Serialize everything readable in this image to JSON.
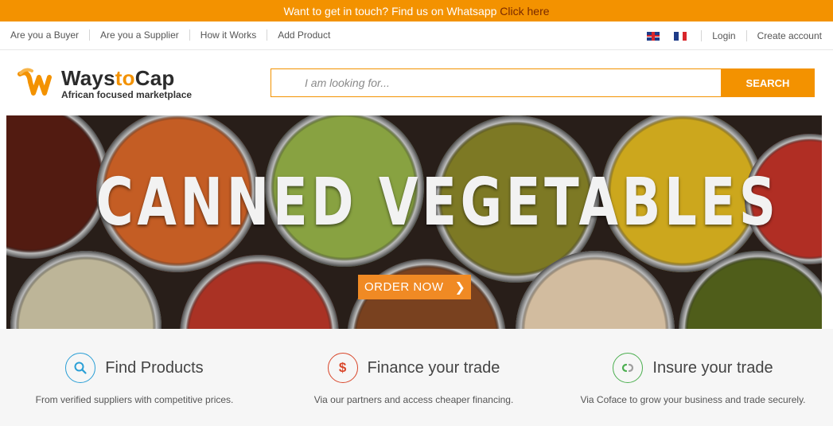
{
  "topbar": {
    "text": "Want to get in touch? Find us on Whatsapp ",
    "cta": "Click here"
  },
  "subnav": {
    "left": [
      "Are you a Buyer",
      "Are you a Supplier",
      "How it Works",
      "Add Product"
    ],
    "login": "Login",
    "create_account": "Create account"
  },
  "logo": {
    "name_a": "Ways",
    "name_b": "to",
    "name_c": "Cap",
    "tagline": "African focused marketplace"
  },
  "search": {
    "placeholder": "I am looking for...",
    "button": "SEARCH"
  },
  "hero": {
    "headline": "CANNED VEGETABLES",
    "cta": "ORDER NOW"
  },
  "features": [
    {
      "title": "Find Products",
      "desc": "From verified suppliers with competitive prices.",
      "icon": "search-icon",
      "color": "#2a9fd6"
    },
    {
      "title": "Finance your trade",
      "desc": "Via our partners and access cheaper financing.",
      "icon": "dollar-icon",
      "color": "#d9472b"
    },
    {
      "title": "Insure your trade",
      "desc": "Via Coface to grow your business and trade securely.",
      "icon": "link-icon",
      "color": "#4caf50"
    }
  ],
  "colors": {
    "brand": "#f39200",
    "dark": "#2b2b2b"
  }
}
